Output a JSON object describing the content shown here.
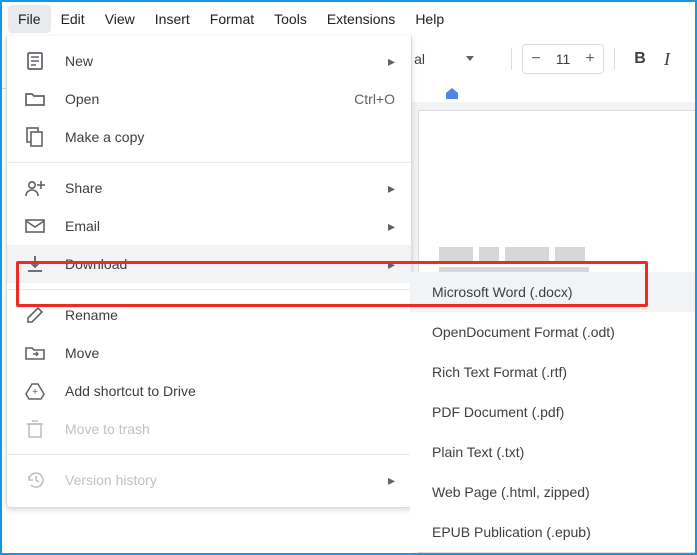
{
  "menubar": [
    "File",
    "Edit",
    "View",
    "Insert",
    "Format",
    "Tools",
    "Extensions",
    "Help"
  ],
  "toolbar": {
    "font_partial": "al",
    "font_size": "11",
    "minus": "−",
    "plus": "+",
    "bold": "B",
    "italic": "I"
  },
  "file_menu": {
    "new": "New",
    "open": "Open",
    "open_shortcut": "Ctrl+O",
    "copy": "Make a copy",
    "share": "Share",
    "email": "Email",
    "download": "Download",
    "rename": "Rename",
    "move": "Move",
    "shortcut": "Add shortcut to Drive",
    "trash": "Move to trash",
    "version": "Version history"
  },
  "download_sub": {
    "docx": "Microsoft Word (.docx)",
    "odt": "OpenDocument Format (.odt)",
    "rtf": "Rich Text Format (.rtf)",
    "pdf": "PDF Document (.pdf)",
    "txt": "Plain Text (.txt)",
    "html": "Web Page (.html, zipped)",
    "epub": "EPUB Publication (.epub)"
  }
}
